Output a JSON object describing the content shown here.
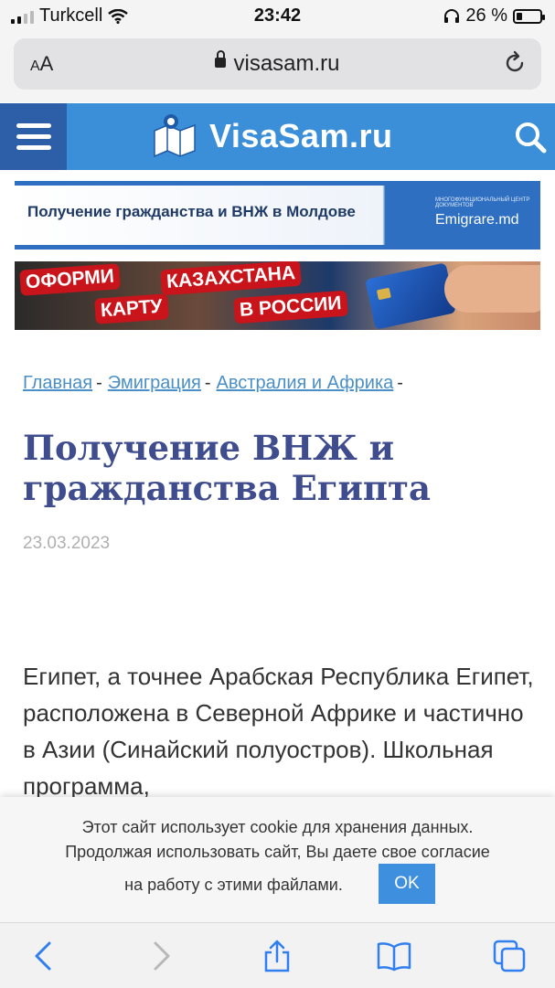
{
  "status_bar": {
    "carrier": "Turkcell",
    "time": "23:42",
    "battery_percent": "26 %",
    "battery_level": 0.26
  },
  "browser": {
    "text_size_label": "AA",
    "url": "visasam.ru"
  },
  "site": {
    "logo_text": "VisaSam.ru"
  },
  "banners": {
    "moldova": {
      "text": "Получение гражданства и ВНЖ в Молдове",
      "brand": "Emigrare.md",
      "brand_tagline": "МНОГОФУНКЦИОНАЛЬНЫЙ ЦЕНТР ДОКУМЕНТОВ"
    },
    "card": {
      "tag1": "ОФОРМИ",
      "tag2": "КАРТУ",
      "tag3": "КАЗАХСТАНА",
      "tag4": "В РОССИИ"
    }
  },
  "breadcrumb": {
    "items": [
      "Главная",
      "Эмиграция",
      "Австралия и Африка"
    ],
    "separator": "-"
  },
  "article": {
    "title": "Получение ВНЖ и гражданства Египта",
    "date": "23.03.2023",
    "paragraph": "Египет, а точнее Арабская Республика Египет, расположена в Северной Африке и частично в Азии (Синайский полуостров). Школьная программа,"
  },
  "cookie": {
    "line1": "Этот сайт использует cookie для хранения данных.",
    "line2": "Продолжая использовать сайт, Вы даете свое согласие",
    "line3": "на работу с этими файлами.",
    "ok_label": "OK"
  },
  "colors": {
    "header": "#3b8fd9",
    "menu_button": "#2d5fa8",
    "title": "#3f4d8f",
    "link": "#4a8fc7",
    "ok_button": "#3f8fdf",
    "toolbar_icon": "#2f7ff0"
  }
}
